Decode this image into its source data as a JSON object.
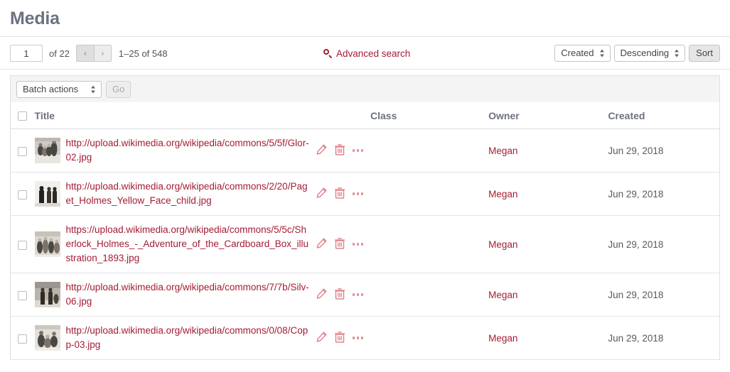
{
  "header": {
    "title": "Media"
  },
  "toolbar": {
    "page_value": "1",
    "page_total": "of 22",
    "prev_icon": "chevron-left-icon",
    "next_icon": "chevron-right-icon",
    "result_range": "1–25 of 548",
    "advanced_search_label": "Advanced search",
    "advanced_search_icon": "search-icon",
    "sort_by": "Created",
    "sort_direction": "Descending",
    "sort_button_label": "Sort"
  },
  "batch": {
    "actions_label": "Batch actions",
    "go_label": "Go"
  },
  "table": {
    "columns": [
      "Title",
      "Class",
      "Owner",
      "Created"
    ],
    "rows": [
      {
        "title": "http://upload.wikimedia.org/wikipedia/commons/5/5f/Glor-02.jpg",
        "class": "",
        "owner": "Megan",
        "created": "Jun 29, 2018",
        "thumbnail": "black-and-white-photo-group-of-people",
        "edit_icon": "pencil-icon",
        "delete_icon": "trash-icon",
        "more_icon": "ellipsis-icon"
      },
      {
        "title": "http://upload.wikimedia.org/wikipedia/commons/2/20/Paget_Holmes_Yellow_Face_child.jpg",
        "class": "",
        "owner": "Megan",
        "created": "Jun 29, 2018",
        "thumbnail": "black-and-white-illustration-three-figures",
        "edit_icon": "pencil-icon",
        "delete_icon": "trash-icon",
        "more_icon": "ellipsis-icon"
      },
      {
        "title": "https://upload.wikimedia.org/wikipedia/commons/5/5c/Sherlock_Holmes_-_Adventure_of_the_Cardboard_Box_illustration_1893.jpg",
        "class": "",
        "owner": "Megan",
        "created": "Jun 29, 2018",
        "thumbnail": "black-and-white-engraving-courtroom",
        "edit_icon": "pencil-icon",
        "delete_icon": "trash-icon",
        "more_icon": "ellipsis-icon"
      },
      {
        "title": "http://upload.wikimedia.org/wikipedia/commons/7/7b/Silv-06.jpg",
        "class": "",
        "owner": "Megan",
        "created": "Jun 29, 2018",
        "thumbnail": "black-and-white-photo-two-men-standing",
        "edit_icon": "pencil-icon",
        "delete_icon": "trash-icon",
        "more_icon": "ellipsis-icon"
      },
      {
        "title": "http://upload.wikimedia.org/wikipedia/commons/0/08/Copp-03.jpg",
        "class": "",
        "owner": "Megan",
        "created": "Jun 29, 2018",
        "thumbnail": "black-and-white-illustration-seated-group",
        "edit_icon": "pencil-icon",
        "delete_icon": "trash-icon",
        "more_icon": "ellipsis-icon"
      }
    ]
  },
  "colors": {
    "accent": "#a41c33",
    "icon_pink": "#e0848f",
    "heading_gray": "#6b7280"
  }
}
